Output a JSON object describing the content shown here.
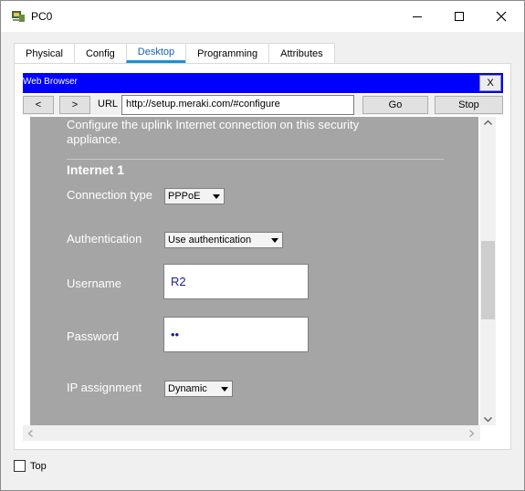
{
  "window": {
    "title": "PC0",
    "icon": "pc-icon"
  },
  "tabs": [
    "Physical",
    "Config",
    "Desktop",
    "Programming",
    "Attributes"
  ],
  "active_tab": "Desktop",
  "browser": {
    "title": "Web Browser",
    "close_label": "X",
    "back_label": "<",
    "forward_label": ">",
    "url_label": "URL",
    "url": "http://setup.meraki.com/#configure",
    "go_label": "Go",
    "stop_label": "Stop"
  },
  "page": {
    "intro": "Configure the uplink Internet connection on this security appliance.",
    "section_title": "Internet 1",
    "connection_type_label": "Connection type",
    "connection_type_value": "PPPoE",
    "authentication_label": "Authentication",
    "authentication_value": "Use authentication",
    "username_label": "Username",
    "username_value": "R2",
    "password_label": "Password",
    "password_value": "••",
    "ip_assignment_label": "IP assignment",
    "ip_assignment_value": "Dynamic"
  },
  "footer": {
    "top_label": "Top",
    "top_checked": false
  },
  "colors": {
    "browser_bar": "#0000ff",
    "page_bg": "#a5a5a5",
    "active_tab": "#1a5fb4"
  }
}
